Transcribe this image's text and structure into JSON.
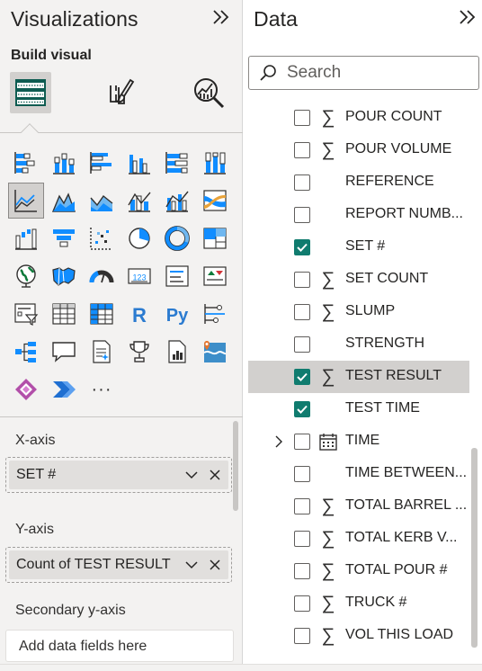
{
  "visualizations": {
    "title": "Visualizations",
    "collapse_icon": "double-chevron-right-icon",
    "build_visual_label": "Build visual",
    "mode_buttons": [
      {
        "name": "build-visual",
        "icon": "fields-icon",
        "active": true
      },
      {
        "name": "format-visual",
        "icon": "paintbrush-icon",
        "active": false
      },
      {
        "name": "analytics",
        "icon": "analytics-magnifier-icon",
        "active": false
      }
    ],
    "visual_icons": [
      "stacked-bar-chart",
      "stacked-column-chart",
      "clustered-bar-chart",
      "clustered-column-chart",
      "100-stacked-bar-chart",
      "100-stacked-column-chart",
      "line-chart",
      "area-chart",
      "stacked-area-chart",
      "line-and-stacked-column-chart",
      "line-and-clustered-column-chart",
      "ribbon-chart",
      "waterfall-chart",
      "funnel-chart",
      "scatter-chart",
      "pie-chart",
      "donut-chart",
      "treemap",
      "map",
      "filled-map",
      "gauge",
      "card",
      "multi-row-card",
      "kpi",
      "slicer",
      "table",
      "matrix",
      "r-script-visual",
      "python-visual",
      "key-influencers",
      "decomposition-tree",
      "qa-visual",
      "smart-narrative",
      "metrics",
      "paginated-report",
      "azure-map",
      "power-apps",
      "power-automate",
      "more-visuals"
    ],
    "r_glyph": "R",
    "py_glyph": "Py",
    "card_glyph": "123",
    "more_glyph": "···",
    "wells": {
      "x_axis": {
        "label": "X-axis",
        "field": "SET #"
      },
      "y_axis": {
        "label": "Y-axis",
        "field": "Count of TEST RESULT"
      },
      "secondary_y_axis": {
        "label": "Secondary y-axis",
        "placeholder": "Add data fields here"
      }
    }
  },
  "data_pane": {
    "title": "Data",
    "collapse_icon": "double-chevron-right-icon",
    "search_placeholder": "Search",
    "fields": [
      {
        "name": "POUR COUNT",
        "sigma": true,
        "checked": false
      },
      {
        "name": "POUR VOLUME",
        "sigma": true,
        "checked": false
      },
      {
        "name": "REFERENCE",
        "sigma": false,
        "checked": false
      },
      {
        "name": "REPORT NUMB...",
        "sigma": false,
        "checked": false
      },
      {
        "name": "SET #",
        "sigma": false,
        "checked": true
      },
      {
        "name": "SET COUNT",
        "sigma": true,
        "checked": false
      },
      {
        "name": "SLUMP",
        "sigma": true,
        "checked": false
      },
      {
        "name": "STRENGTH",
        "sigma": false,
        "checked": false
      },
      {
        "name": "TEST RESULT",
        "sigma": true,
        "checked": true,
        "hover": true
      },
      {
        "name": "TEST TIME",
        "sigma": false,
        "checked": true
      },
      {
        "name": "TIME",
        "sigma": false,
        "checked": false,
        "calendar": true,
        "expandable": true
      },
      {
        "name": "TIME BETWEEN...",
        "sigma": false,
        "checked": false
      },
      {
        "name": "TOTAL BARREL ...",
        "sigma": true,
        "checked": false
      },
      {
        "name": "TOTAL KERB V...",
        "sigma": true,
        "checked": false
      },
      {
        "name": "TOTAL POUR #",
        "sigma": true,
        "checked": false
      },
      {
        "name": "TRUCK #",
        "sigma": true,
        "checked": false
      },
      {
        "name": "VOL THIS LOAD",
        "sigma": true,
        "checked": false
      }
    ],
    "sigma_glyph": "∑"
  },
  "colors": {
    "accent_teal": "#107c6f",
    "chart_blue": "#118dff",
    "chart_light_blue": "#6fb7f0",
    "pane_bg": "#f3f2f1"
  }
}
